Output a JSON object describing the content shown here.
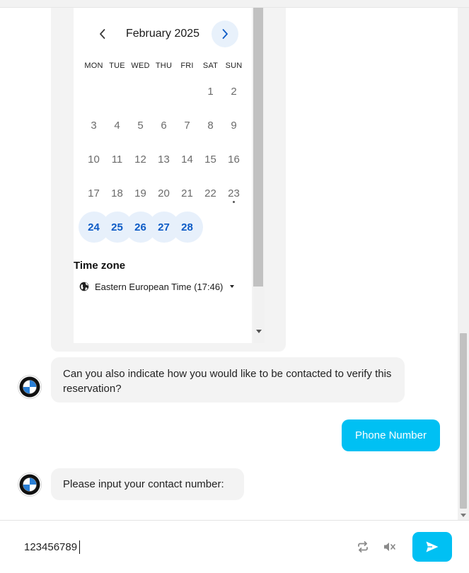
{
  "calendar": {
    "month_label": "February 2025",
    "prev_icon": "chevron-left-icon",
    "next_icon": "chevron-right-icon",
    "weekdays": [
      "MON",
      "TUE",
      "WED",
      "THU",
      "FRI",
      "SAT",
      "SUN"
    ],
    "days": [
      "1",
      "2",
      "3",
      "4",
      "5",
      "6",
      "7",
      "8",
      "9",
      "10",
      "11",
      "12",
      "13",
      "14",
      "15",
      "16",
      "17",
      "18",
      "19",
      "20",
      "21",
      "22",
      "23",
      "24",
      "25",
      "26",
      "27",
      "28"
    ],
    "available_days": [
      "24",
      "25",
      "26",
      "27",
      "28"
    ],
    "today": "23",
    "timezone_title": "Time zone",
    "timezone_value": "Eastern European Time (17:46)",
    "timezone_icon": "globe-icon"
  },
  "messages": {
    "bot_contact_question": "Can you also indicate how you would like to be contacted to verify this reservation?",
    "user_choice": "Phone Number",
    "bot_number_prompt": "Please input your contact number:"
  },
  "input": {
    "value": "123456789",
    "refresh_icon": "refresh-icon",
    "mute_icon": "speaker-muted-icon",
    "send_icon": "send-icon"
  },
  "colors": {
    "accent": "#00c0f3",
    "available_day_text": "#0d5bc6",
    "available_day_bg": "#e7f0fb",
    "bubble_bg": "#f3f3f3"
  }
}
